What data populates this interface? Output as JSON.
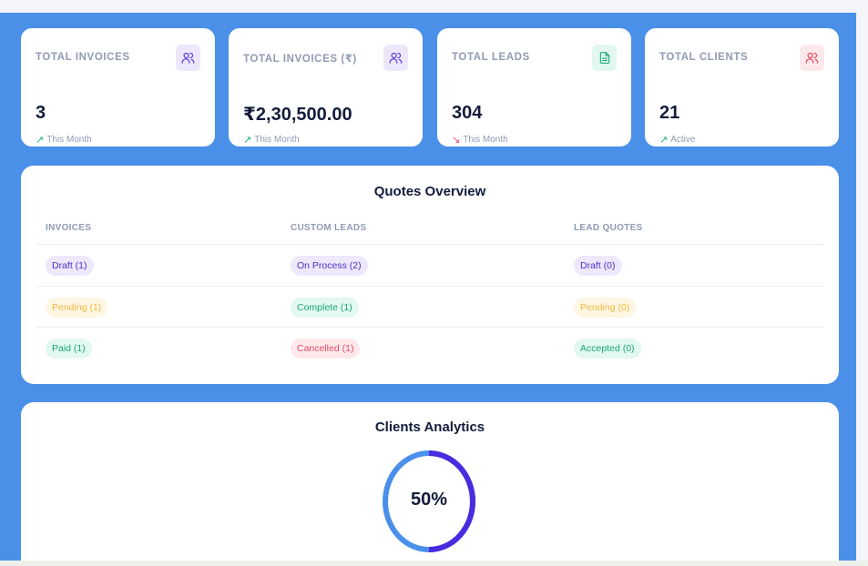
{
  "stats": [
    {
      "title": "TOTAL INVOICES",
      "value": "3",
      "foot": "This Month",
      "trend": "up",
      "icon": "users-icon",
      "icon_bg": "#ece7fb",
      "icon_color": "#5b3ee0"
    },
    {
      "title": "TOTAL INVOICES (₹)",
      "value": "₹2,30,500.00",
      "foot": "This Month",
      "trend": "up",
      "icon": "users-icon",
      "icon_bg": "#ece7fb",
      "icon_color": "#5b3ee0"
    },
    {
      "title": "TOTAL LEADS",
      "value": "304",
      "foot": "This Month",
      "trend": "down",
      "icon": "document-icon",
      "icon_bg": "#e2f7ef",
      "icon_color": "#1aa77a"
    },
    {
      "title": "TOTAL CLIENTS",
      "value": "21",
      "foot": "Active",
      "trend": "up",
      "icon": "users-icon",
      "icon_bg": "#fde9ec",
      "icon_color": "#e94a63"
    }
  ],
  "quotes": {
    "title": "Quotes Overview",
    "columns": [
      {
        "header": "INVOICES",
        "items": [
          {
            "label": "Draft (1)",
            "color": "purple"
          },
          {
            "label": "Pending (1)",
            "color": "yellow"
          },
          {
            "label": "Paid (1)",
            "color": "green"
          }
        ]
      },
      {
        "header": "CUSTOM LEADS",
        "items": [
          {
            "label": "On Process (2)",
            "color": "purple"
          },
          {
            "label": "Complete (1)",
            "color": "green"
          },
          {
            "label": "Cancelled (1)",
            "color": "red"
          }
        ]
      },
      {
        "header": "LEAD QUOTES",
        "items": [
          {
            "label": "Draft (0)",
            "color": "purple"
          },
          {
            "label": "Pending (0)",
            "color": "yellow"
          },
          {
            "label": "Accepted (0)",
            "color": "green"
          }
        ]
      }
    ]
  },
  "analytics": {
    "title": "Clients Analytics",
    "percent_label": "50%",
    "percent": 50,
    "colors": {
      "progress": "#4a2be0",
      "track": "#4a90e9"
    }
  },
  "colors": {
    "background": "#4a90e9",
    "up": "#22b07d",
    "down": "#ef4a5e"
  }
}
